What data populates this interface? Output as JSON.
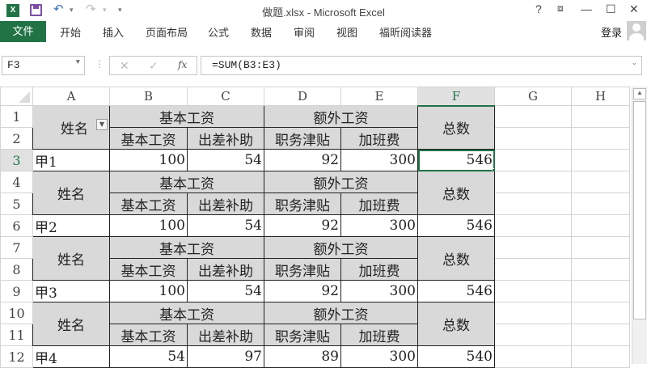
{
  "window": {
    "title": "做题.xlsx - Microsoft Excel",
    "help": "?",
    "restore_ribbon": "⧈",
    "minimize": "—",
    "maximize": "☐",
    "close": "✕"
  },
  "qat": {
    "app_icon": "X",
    "undo": "↶",
    "redo": "↷",
    "customize": "▾"
  },
  "ribbon": {
    "file": "文件",
    "tabs": [
      "开始",
      "插入",
      "页面布局",
      "公式",
      "数据",
      "审阅",
      "视图",
      "福昕阅读器"
    ],
    "login": "登录"
  },
  "formula_bar": {
    "name_box": "F3",
    "cancel": "✕",
    "enter": "✓",
    "fx": "fx",
    "formula": "=SUM(B3:E3)"
  },
  "columns": [
    "A",
    "B",
    "C",
    "D",
    "E",
    "F",
    "G",
    "H"
  ],
  "selected_cell": "F3",
  "header_labels": {
    "name": "姓名",
    "basic_group": "基本工资",
    "extra_group": "额外工资",
    "basic": "基本工资",
    "travel": "出差补助",
    "duty": "职务津贴",
    "overtime": "加班费",
    "total": "总数"
  },
  "blocks": [
    {
      "rows": [
        "1",
        "2",
        "3"
      ],
      "name": "甲1",
      "values": [
        "100",
        "54",
        "92",
        "300",
        "546"
      ]
    },
    {
      "rows": [
        "4",
        "5",
        "6"
      ],
      "name": "甲2",
      "values": [
        "100",
        "54",
        "92",
        "300",
        "546"
      ]
    },
    {
      "rows": [
        "7",
        "8",
        "9"
      ],
      "name": "甲3",
      "values": [
        "100",
        "54",
        "92",
        "300",
        "546"
      ]
    },
    {
      "rows": [
        "10",
        "11",
        "12"
      ],
      "name": "甲4",
      "values": [
        "54",
        "97",
        "89",
        "300",
        "540"
      ]
    }
  ]
}
